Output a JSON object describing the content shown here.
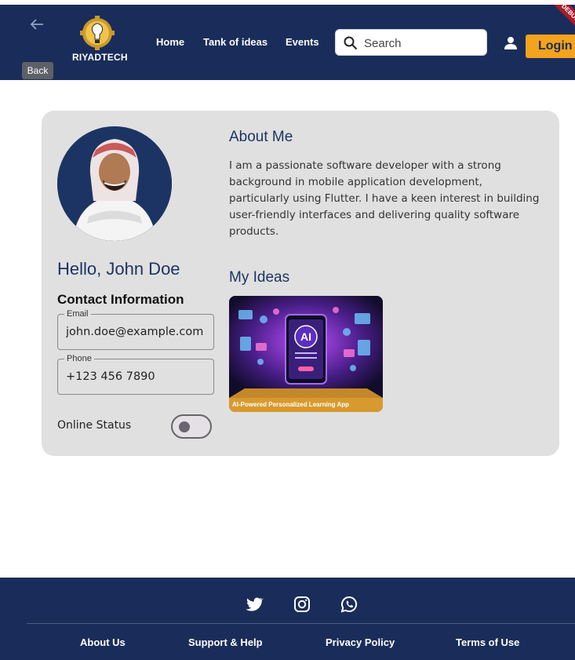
{
  "header": {
    "back_label": "Back",
    "logo_text": "RIYADTECH",
    "nav": [
      {
        "label": "Home"
      },
      {
        "label": "Tank of ideas"
      },
      {
        "label": "Events"
      }
    ],
    "search": {
      "placeholder": "Search",
      "value": ""
    },
    "login_label": "Login",
    "debug_banner": "DEBUG"
  },
  "profile": {
    "greeting": "Hello, John Doe",
    "contact_title": "Contact Information",
    "email_label": "Email",
    "email_value": "john.doe@example.com",
    "phone_label": "Phone",
    "phone_value": "+123 456 7890",
    "status_label": "Online Status",
    "online": false
  },
  "about": {
    "title": "About Me",
    "text": "I am a passionate software developer with a strong background in mobile application development, particularly using Flutter. I have a keen interest in building user-friendly interfaces and delivering quality software products."
  },
  "ideas": {
    "title": "My Ideas",
    "items": [
      {
        "caption": "AI-Powered Personalized Learning App",
        "badge": "AI"
      }
    ]
  },
  "footer": {
    "social": [
      "twitter-icon",
      "instagram-icon",
      "whatsapp-icon"
    ],
    "links": [
      {
        "label": "About Us"
      },
      {
        "label": "Support & Help"
      },
      {
        "label": "Privacy Policy"
      },
      {
        "label": "Terms of Use"
      }
    ]
  },
  "colors": {
    "navy": "#1a2d5a",
    "accent": "#f3a31c",
    "card_bg": "#e0e0e0",
    "heading": "#1c3463"
  }
}
